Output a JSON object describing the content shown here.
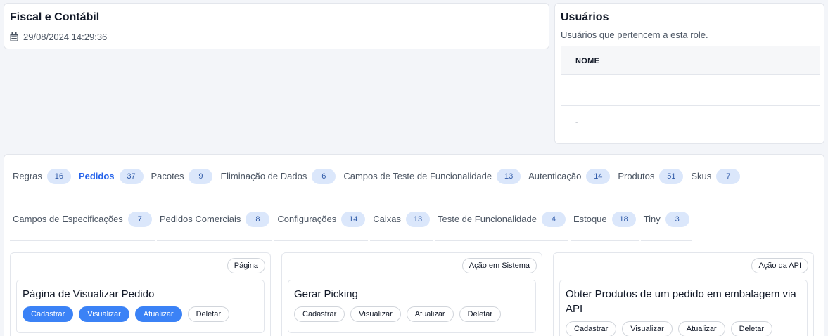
{
  "header": {
    "title": "Fiscal e Contábil",
    "timestamp": "29/08/2024 14:29:36",
    "calendar_icon": "calendar-icon"
  },
  "users": {
    "title": "Usuários",
    "subtitle": "Usuários que pertencem a esta role.",
    "columns": [
      "NOME"
    ],
    "empty_marker": "-"
  },
  "tabs_row1": [
    {
      "label": "Regras",
      "count": "16",
      "active": false
    },
    {
      "label": "Pedidos",
      "count": "37",
      "active": true
    },
    {
      "label": "Pacotes",
      "count": "9",
      "active": false
    },
    {
      "label": "Eliminação de Dados",
      "count": "6",
      "active": false
    },
    {
      "label": "Campos de Teste de Funcionalidade",
      "count": "13",
      "active": false
    },
    {
      "label": "Autenticação",
      "count": "14",
      "active": false
    },
    {
      "label": "Produtos",
      "count": "51",
      "active": false
    },
    {
      "label": "Skus",
      "count": "7",
      "active": false
    }
  ],
  "tabs_row2": [
    {
      "label": "Campos de Especificações",
      "count": "7",
      "active": false
    },
    {
      "label": "Pedidos Comerciais",
      "count": "8",
      "active": false
    },
    {
      "label": "Configurações",
      "count": "14",
      "active": false
    },
    {
      "label": "Caixas",
      "count": "13",
      "active": false
    },
    {
      "label": "Teste de Funcionalidade",
      "count": "4",
      "active": false
    },
    {
      "label": "Estoque",
      "count": "18",
      "active": false
    },
    {
      "label": "Tiny",
      "count": "3",
      "active": false
    }
  ],
  "cards": [
    {
      "type": "Página",
      "title": "Página de Visualizar Pedido",
      "actions": [
        {
          "label": "Cadastrar",
          "enabled": true
        },
        {
          "label": "Visualizar",
          "enabled": true
        },
        {
          "label": "Atualizar",
          "enabled": true
        },
        {
          "label": "Deletar",
          "enabled": false
        }
      ]
    },
    {
      "type": "Ação em Sistema",
      "title": "Gerar Picking",
      "actions": [
        {
          "label": "Cadastrar",
          "enabled": false
        },
        {
          "label": "Visualizar",
          "enabled": false
        },
        {
          "label": "Atualizar",
          "enabled": false
        },
        {
          "label": "Deletar",
          "enabled": false
        }
      ]
    },
    {
      "type": "Ação da API",
      "title": "Obter Produtos de um pedido em embalagem via API",
      "actions": [
        {
          "label": "Cadastrar",
          "enabled": false
        },
        {
          "label": "Visualizar",
          "enabled": false
        },
        {
          "label": "Atualizar",
          "enabled": false
        },
        {
          "label": "Deletar",
          "enabled": false
        }
      ]
    }
  ],
  "colors": {
    "accent": "#2563eb",
    "action_on": "#3b82f6",
    "count_bg": "#dbe7fb"
  }
}
